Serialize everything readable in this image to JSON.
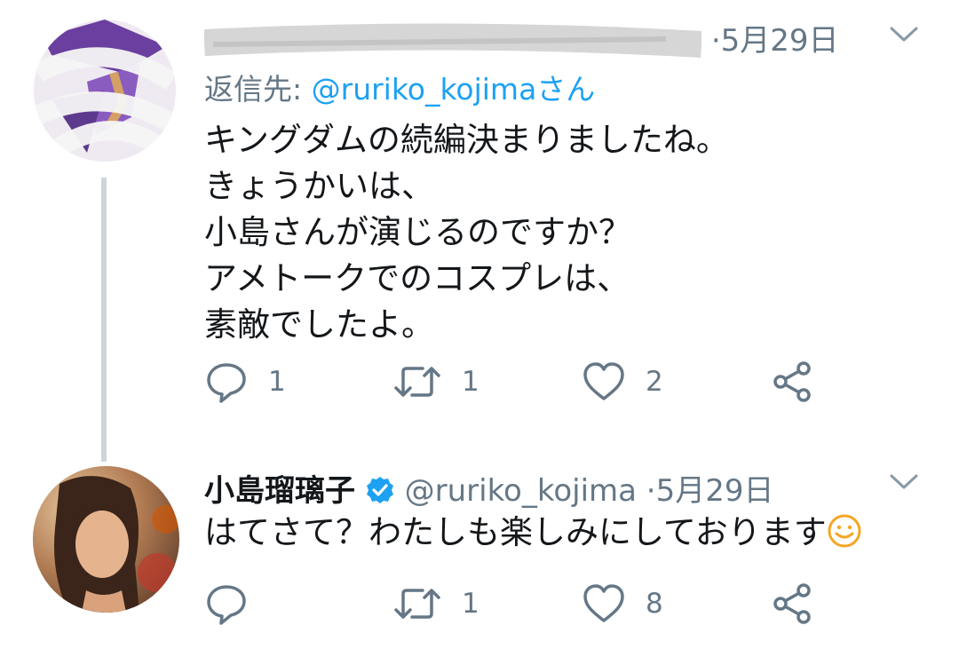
{
  "tweet1": {
    "name_obscured": "",
    "time": "5月29日",
    "reply_prefix": "返信先:",
    "reply_mention": "@ruriko_kojima",
    "reply_suffix": "さん",
    "lines": [
      "キングダムの続編決まりましたね。",
      "きょうかいは、",
      "小島さんが演じるのですか？",
      "アメトークでのコスプレは、",
      "素敵でしたよ。"
    ],
    "replies": "1",
    "retweets": "1",
    "likes": "2"
  },
  "tweet2": {
    "name": "小島瑠璃子",
    "handle": "@ruriko_kojima",
    "separator": "·",
    "time": "5月29日",
    "text": "はてさて？わたしも楽しみにしております",
    "emoji": "smiling-face-emoji",
    "replies": "",
    "retweets": "1",
    "likes": "8"
  },
  "icons": {
    "reply": "reply-icon",
    "retweet": "retweet-icon",
    "like": "heart-icon",
    "share": "share-icon",
    "caret": "chevron-down-icon",
    "verified": "verified-badge-icon"
  },
  "colors": {
    "text": "#14171a",
    "secondary": "#657786",
    "accent": "#1da1f2",
    "emoji": "#f5a623"
  }
}
